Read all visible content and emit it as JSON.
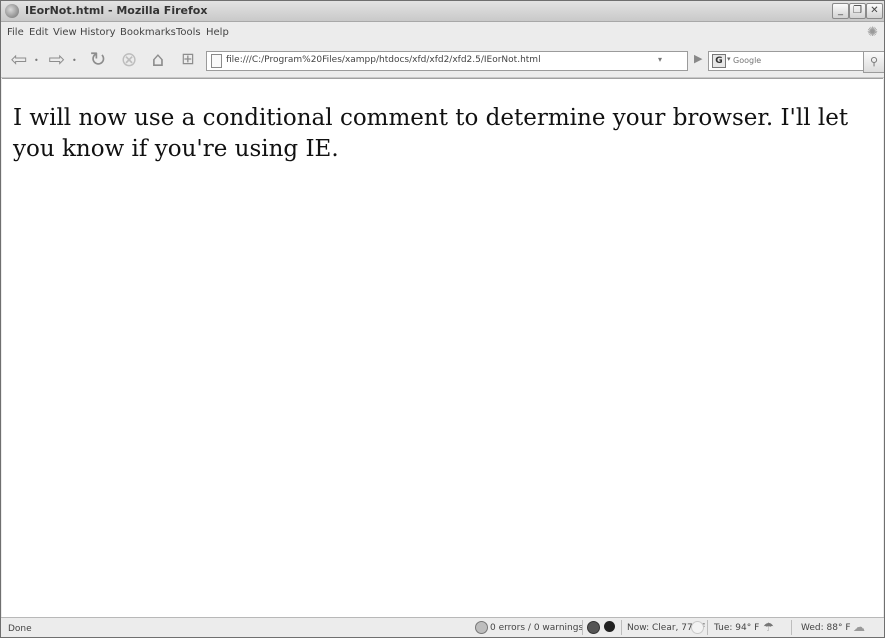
{
  "window": {
    "title": "IEorNot.html - Mozilla Firefox",
    "controls": {
      "minimize": "_",
      "restore": "❐",
      "close": "✕"
    }
  },
  "menu": {
    "items": [
      "File",
      "Edit",
      "View",
      "History",
      "Bookmarks",
      "Tools",
      "Help"
    ]
  },
  "toolbar": {
    "back_icon": "back-arrow-icon",
    "forward_icon": "forward-arrow-icon",
    "reload_icon": "reload-icon",
    "stop_icon": "stop-icon",
    "home_icon": "home-icon",
    "new_tab_icon": "new-tab-icon",
    "go_icon": "go-icon",
    "search_icon": "magnifier-icon"
  },
  "address": {
    "url": "file:///C:/Program%20Files/xampp/htdocs/xfd/xfd2/xfd2.5/IEorNot.html"
  },
  "search": {
    "engine_label": "G",
    "placeholder": "Google"
  },
  "page": {
    "body_text": "I will now use a conditional comment to determine your browser. I'll let you know if you're using IE."
  },
  "status": {
    "text": "Done",
    "errors": "0 errors / 0 warnings",
    "weather_now": "Now: Clear, 77° F",
    "weather_tue": "Tue: 94° F",
    "weather_wed": "Wed: 88° F"
  },
  "colors": {
    "chrome_bg": "#ececec",
    "content_bg": "#ffffff",
    "text": "#111111"
  }
}
